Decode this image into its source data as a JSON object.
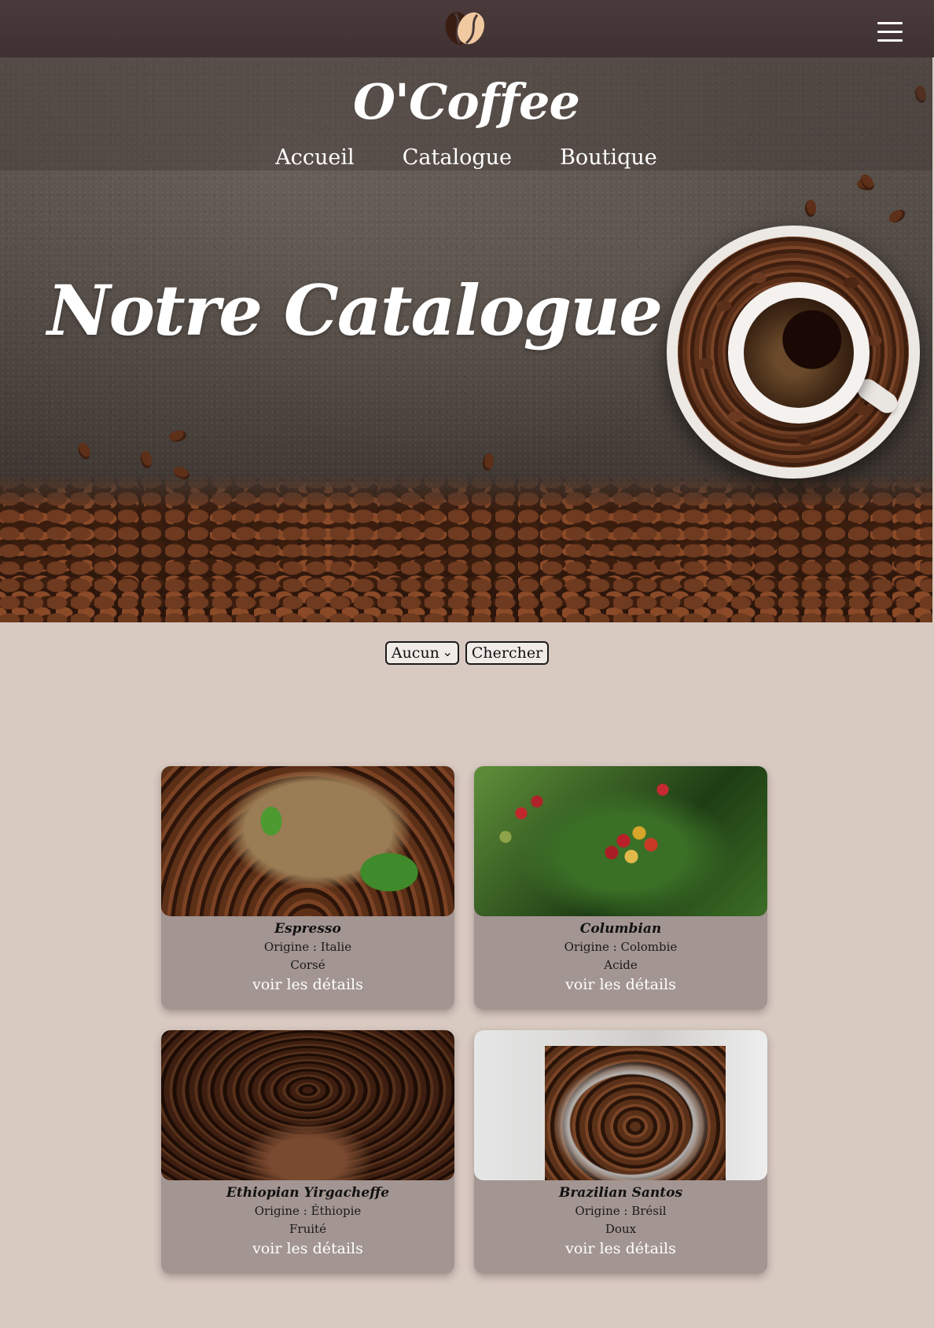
{
  "header": {
    "logo_icon": "coffee-bean-icon",
    "menu_icon": "hamburger-menu-icon",
    "brand": "O'Coffee",
    "nav": [
      "Accueil",
      "Catalogue",
      "Boutique"
    ]
  },
  "hero": {
    "title": "Notre Catalogue"
  },
  "filter": {
    "select_value": "Aucun",
    "button_label": "Chercher"
  },
  "products": [
    {
      "name": "Espresso",
      "origin": "Origine : Italie",
      "note": "Corsé",
      "link": "voir les détails"
    },
    {
      "name": "Columbian",
      "origin": "Origine : Colombie",
      "note": "Acide",
      "link": "voir les détails"
    },
    {
      "name": "Ethiopian Yirgacheffe",
      "origin": "Origine : Éthiopie",
      "note": "Fruité",
      "link": "voir les détails"
    },
    {
      "name": "Brazilian Santos",
      "origin": "Origine : Brésil",
      "note": "Doux",
      "link": "voir les détails"
    }
  ],
  "colors": {
    "topbar": "#4a3a3b",
    "page_bg": "#d8c9c1",
    "card_bg": "#a39592"
  }
}
